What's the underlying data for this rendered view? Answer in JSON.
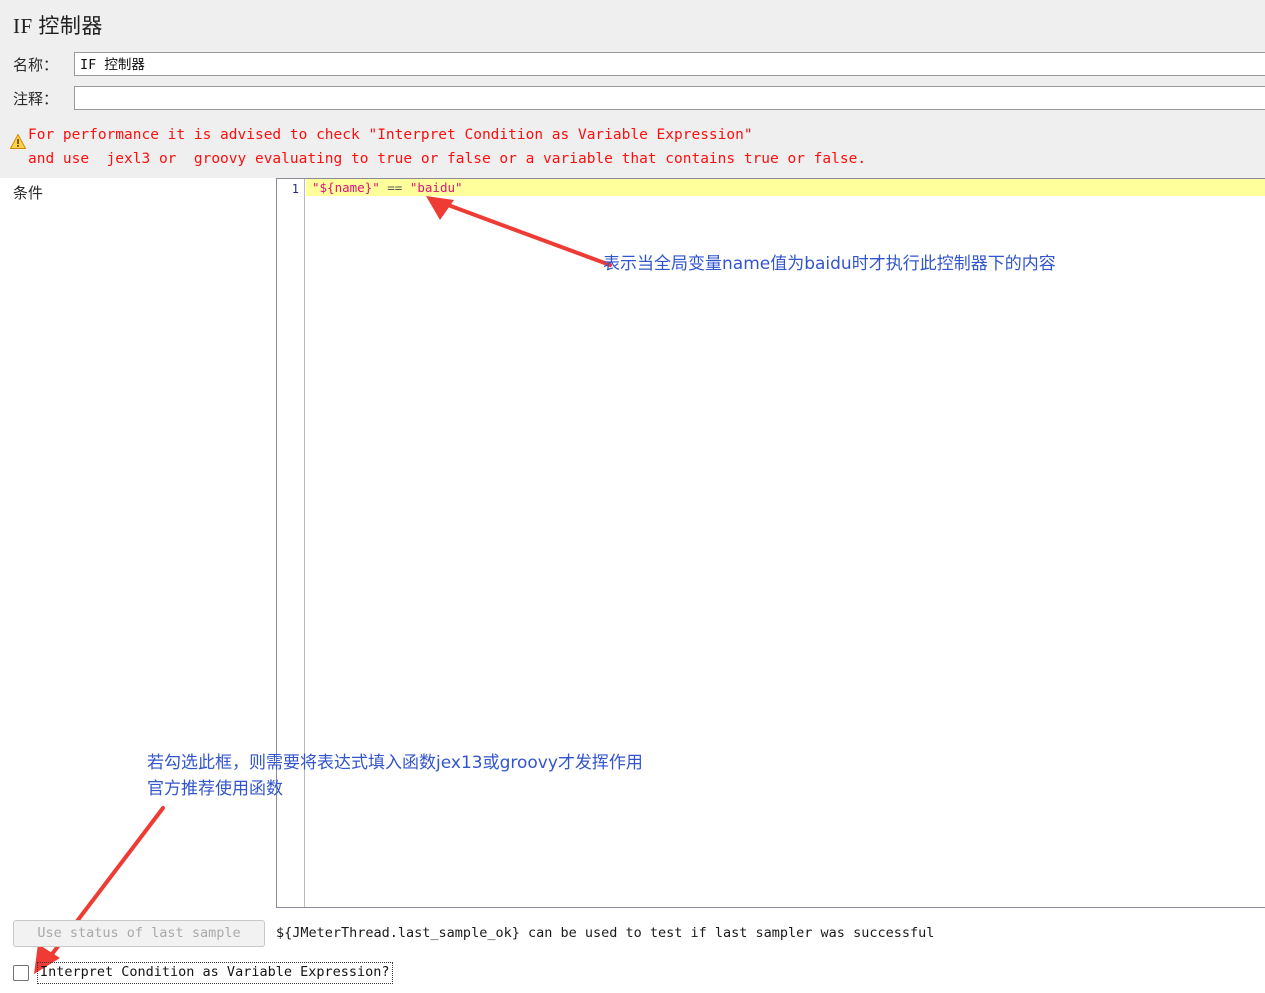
{
  "window": {
    "title": "IF 控制器",
    "background": "#efefef"
  },
  "form": {
    "name_label": "名称：",
    "name_value": "IF 控制器",
    "comment_label": "注释：",
    "comment_value": "",
    "comment_placeholder": ""
  },
  "warning": {
    "icon": "warning-triangle-icon",
    "line1": "For performance it is advised to check \"Interpret Condition as Variable Expression\"",
    "line2": "and use  jexl3 or  groovy evaluating to true or false or a variable that contains true or false.",
    "color": "#ff0e0e"
  },
  "condition": {
    "label": "条件",
    "line_number": "1",
    "code_tokens": {
      "var_expr": "\"${name}\"",
      "operator": " == ",
      "literal": "\"baidu\""
    },
    "highlight_color": "#ffff9c",
    "string_color": "#e2127a"
  },
  "annotations": {
    "arrow_color": "#ee3b33",
    "text_color": "#3355cc",
    "condition_note": "表示当全局变量name值为baidu时才执行此控制器下的内容",
    "checkbox_note_line1": "若勾选此框，则需要将表达式填入函数jex13或groovy才发挥作用",
    "checkbox_note_line2": "官方推荐使用函数"
  },
  "bottom": {
    "last_sample_button": "Use status of last sample",
    "last_sample_hint": "${JMeterThread.last_sample_ok} can be used to test if last sampler was successful",
    "interpret_checkbox_label": "Interpret Condition as Variable Expression?",
    "interpret_checked": false
  }
}
